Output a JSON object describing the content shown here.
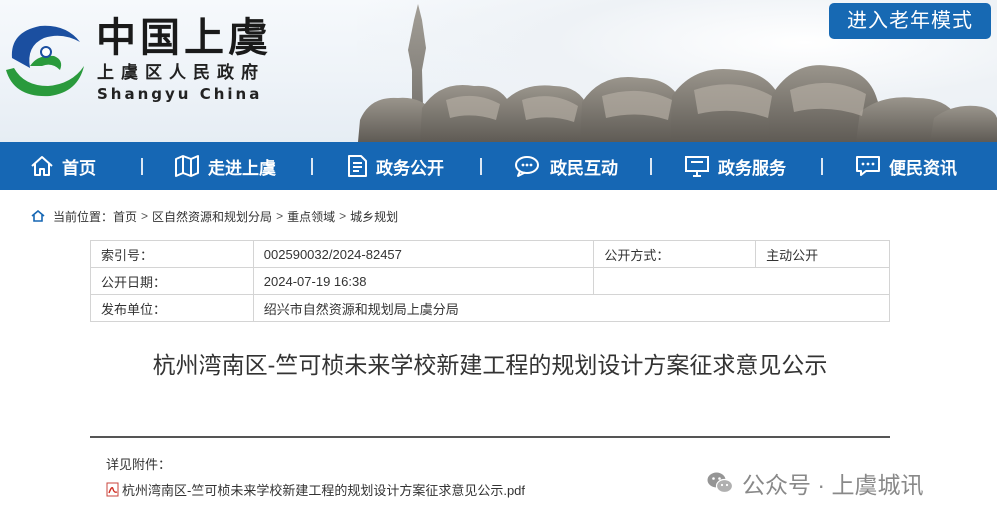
{
  "header": {
    "logo_main": "中国上虞",
    "logo_district": "上虞区人民政府",
    "logo_english": "Shangyu China",
    "elder_mode_label": "进入老年模式"
  },
  "nav": {
    "items": [
      {
        "label": "首页",
        "icon": "home-icon"
      },
      {
        "label": "走进上虞",
        "icon": "map-icon"
      },
      {
        "label": "政务公开",
        "icon": "document-icon"
      },
      {
        "label": "政民互动",
        "icon": "chat-icon"
      },
      {
        "label": "政务服务",
        "icon": "monitor-icon"
      },
      {
        "label": "便民资讯",
        "icon": "message-icon"
      }
    ]
  },
  "breadcrumb": {
    "prefix": "当前位置：",
    "items": [
      "首页",
      "区自然资源和规划分局",
      "重点领域",
      "城乡规划"
    ],
    "separator": ">"
  },
  "meta": {
    "index_label": "索引号：",
    "index_value": "002590032/2024-82457",
    "open_mode_label": "公开方式：",
    "open_mode_value": "主动公开",
    "date_label": "公开日期：",
    "date_value": "2024-07-19 16:38",
    "publisher_label": "发布单位：",
    "publisher_value": "绍兴市自然资源和规划局上虞分局"
  },
  "article": {
    "title": "杭州湾南区-竺可桢未来学校新建工程的规划设计方案征求意见公示",
    "attachments_label": "详见附件：",
    "attachment_file": "杭州湾南区-竺可桢未来学校新建工程的规划设计方案征求意见公示.pdf"
  },
  "watermark": {
    "text": "公众号 · 上虞城讯"
  },
  "colors": {
    "nav_blue": "#1667b4",
    "elder_button": "#1769b3",
    "logo_blue": "#1b4fa0",
    "logo_green": "#2a9a3c"
  }
}
